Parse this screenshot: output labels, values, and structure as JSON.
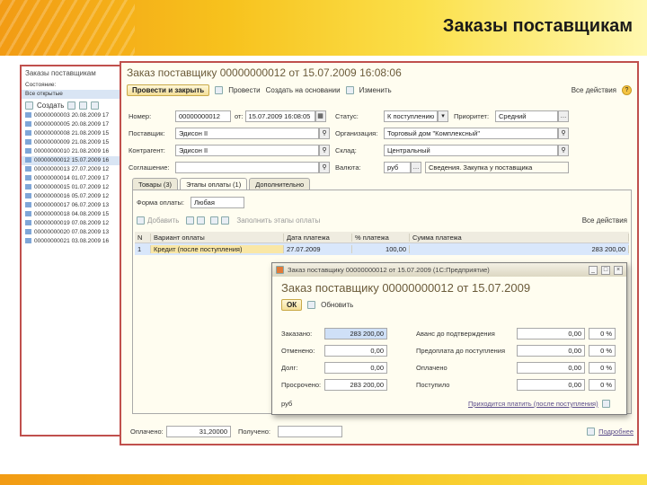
{
  "slide": {
    "title": "Заказы поставщикам"
  },
  "list_window": {
    "title": "Заказы поставщикам",
    "filter_label": "Состояние:",
    "filter_value": "Все открытые",
    "toolbar": {
      "create_label": "Создать"
    },
    "rows": [
      "00000000003 20.08.2009 17",
      "00000000005 20.08.2009 17",
      "00000000008 21.08.2009 15",
      "00000000009 21.08.2009 15",
      "00000000010 21.08.2009 16",
      "00000000012 15.07.2009 16",
      "00000000013 27.07.2009 12",
      "00000000014 01.07.2009 17",
      "00000000015 01.07.2009 12",
      "00000000016 05.07.2009 12",
      "00000000017 06.07.2009 13",
      "00000000018 04.08.2009 15",
      "00000000019 07.08.2009 12",
      "00000000020 07.08.2009 13",
      "00000000021 03.08.2009 16"
    ],
    "selected_row": 5
  },
  "doc_window": {
    "title": "Заказ поставщику 00000000012 от 15.07.2009 16:08:06",
    "toolbar": {
      "post_close": "Провести и закрыть",
      "post": "Провести",
      "create_based": "Создать на основании",
      "change": "Изменить",
      "all_actions": "Все действия",
      "help": "?"
    },
    "fields": {
      "number_label": "Номер:",
      "number_value": "00000000012",
      "date_label": "от:",
      "date_value": "15.07.2009 16:08:05",
      "status_label": "Статус:",
      "status_value": "К поступлению",
      "priority_label": "Приоритет:",
      "priority_value": "Средний",
      "supplier_label": "Поставщик:",
      "supplier_value": "Эдисон II",
      "organization_label": "Организация:",
      "organization_value": "Торговый дом \"Комплексный\"",
      "counterparty_label": "Контрагент:",
      "counterparty_value": "Эдисон II",
      "warehouse_label": "Склад:",
      "warehouse_value": "Центральный",
      "agreement_label": "Соглашение:",
      "agreement_value": "",
      "currency_label": "Валюта:",
      "currency_value": "руб",
      "details_value": "Сведения. Закупка у поставщика"
    },
    "tabs": [
      "Товары (3)",
      "Этапы оплаты (1)",
      "Дополнительно"
    ],
    "active_tab": 1,
    "payment_tab": {
      "form_label": "Форма оплаты:",
      "form_value": "Любая",
      "add_label": "Добавить",
      "fill_label": "Заполнить этапы оплаты",
      "all_actions": "Все действия",
      "columns": [
        "N",
        "Вариант оплаты",
        "Дата платежа",
        "% платежа",
        "Сумма платежа"
      ],
      "rows": [
        [
          "1",
          "Кредит (после поступления)",
          "27.07.2009",
          "100,00",
          "283 200,00"
        ]
      ]
    },
    "footer": {
      "paid_label": "Оплачено:",
      "paid_value": "31,20000",
      "received_label": "Получено:",
      "received_value": "",
      "more_label": "Подробнее"
    }
  },
  "popup": {
    "window_title": "Заказ поставщику 00000000012 от 15.07.2009 (1С:Предприятие)",
    "heading": "Заказ поставщику 00000000012 от 15.07.2009",
    "ok_label": "ОК",
    "refresh_label": "Обновить",
    "left_rows": [
      {
        "label": "Заказано:",
        "value": "283 200,00"
      },
      {
        "label": "Отменено:",
        "value": "0,00"
      },
      {
        "label": "Долг:",
        "value": "0,00"
      },
      {
        "label": "Просрочено:",
        "value": "283 200,00"
      }
    ],
    "right_rows": [
      {
        "label": "Аванс до подтверждения",
        "value": "0,00",
        "pct": "0 %"
      },
      {
        "label": "Предоплата до поступления",
        "value": "0,00",
        "pct": "0 %"
      },
      {
        "label": "Оплачено",
        "value": "0,00",
        "pct": "0 %"
      },
      {
        "label": "Поступило",
        "value": "0,00",
        "pct": "0 %"
      }
    ],
    "currency": "руб",
    "bottom_link": "Приходится платить (после поступления)"
  },
  "colors": {
    "header_start": "#f29b14",
    "header_end": "#fff8b0",
    "highlight_border": "#c0504d"
  }
}
